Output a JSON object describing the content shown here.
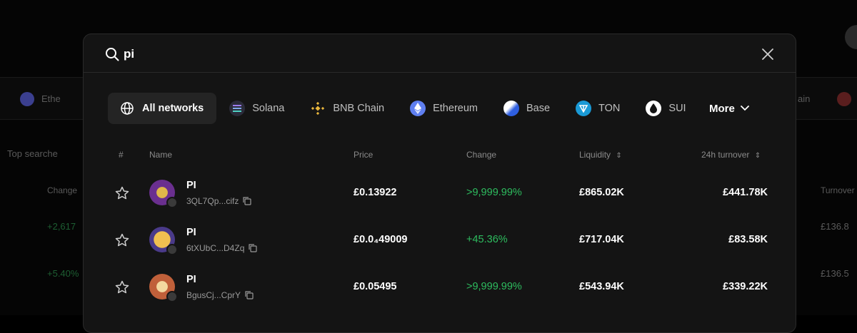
{
  "background": {
    "chain_label_left": "Ethe",
    "chain_label_right": "ain",
    "top_searched_label": "Top searche",
    "change_header": "Change",
    "turnover_header": "Turnover",
    "rows": [
      {
        "change": "+2,617",
        "turnover": "£136.8"
      },
      {
        "change": "+5.40%",
        "turnover": "£136.5"
      }
    ]
  },
  "search": {
    "value": "pi",
    "placeholder": "Search"
  },
  "networks": [
    {
      "label": "All networks",
      "icon": "globe-icon",
      "active": true
    },
    {
      "label": "Solana",
      "icon": "solana-icon"
    },
    {
      "label": "BNB Chain",
      "icon": "bnb-icon"
    },
    {
      "label": "Ethereum",
      "icon": "ethereum-icon"
    },
    {
      "label": "Base",
      "icon": "base-icon"
    },
    {
      "label": "TON",
      "icon": "ton-icon"
    },
    {
      "label": "SUI",
      "icon": "sui-icon"
    }
  ],
  "more_label": "More",
  "table": {
    "headers": {
      "index": "#",
      "name": "Name",
      "price": "Price",
      "change": "Change",
      "liquidity": "Liquidity",
      "turnover": "24h turnover"
    },
    "rows": [
      {
        "name": "PI",
        "address": "3QL7Qp...cifz",
        "price": "£0.13922",
        "change": ">9,999.99%",
        "liquidity": "£865.02K",
        "turnover": "£441.78K"
      },
      {
        "name": "PI",
        "address": "6tXUbC...D4Zq",
        "price": "£0.0₄49009",
        "change": "+45.36%",
        "liquidity": "£717.04K",
        "turnover": "£83.58K"
      },
      {
        "name": "PI",
        "address": "BgusCj...CprY",
        "price": "£0.05495",
        "change": ">9,999.99%",
        "liquidity": "£543.94K",
        "turnover": "£339.22K"
      }
    ]
  },
  "colors": {
    "positive": "#2ebd5f",
    "modal_bg": "#141414"
  }
}
